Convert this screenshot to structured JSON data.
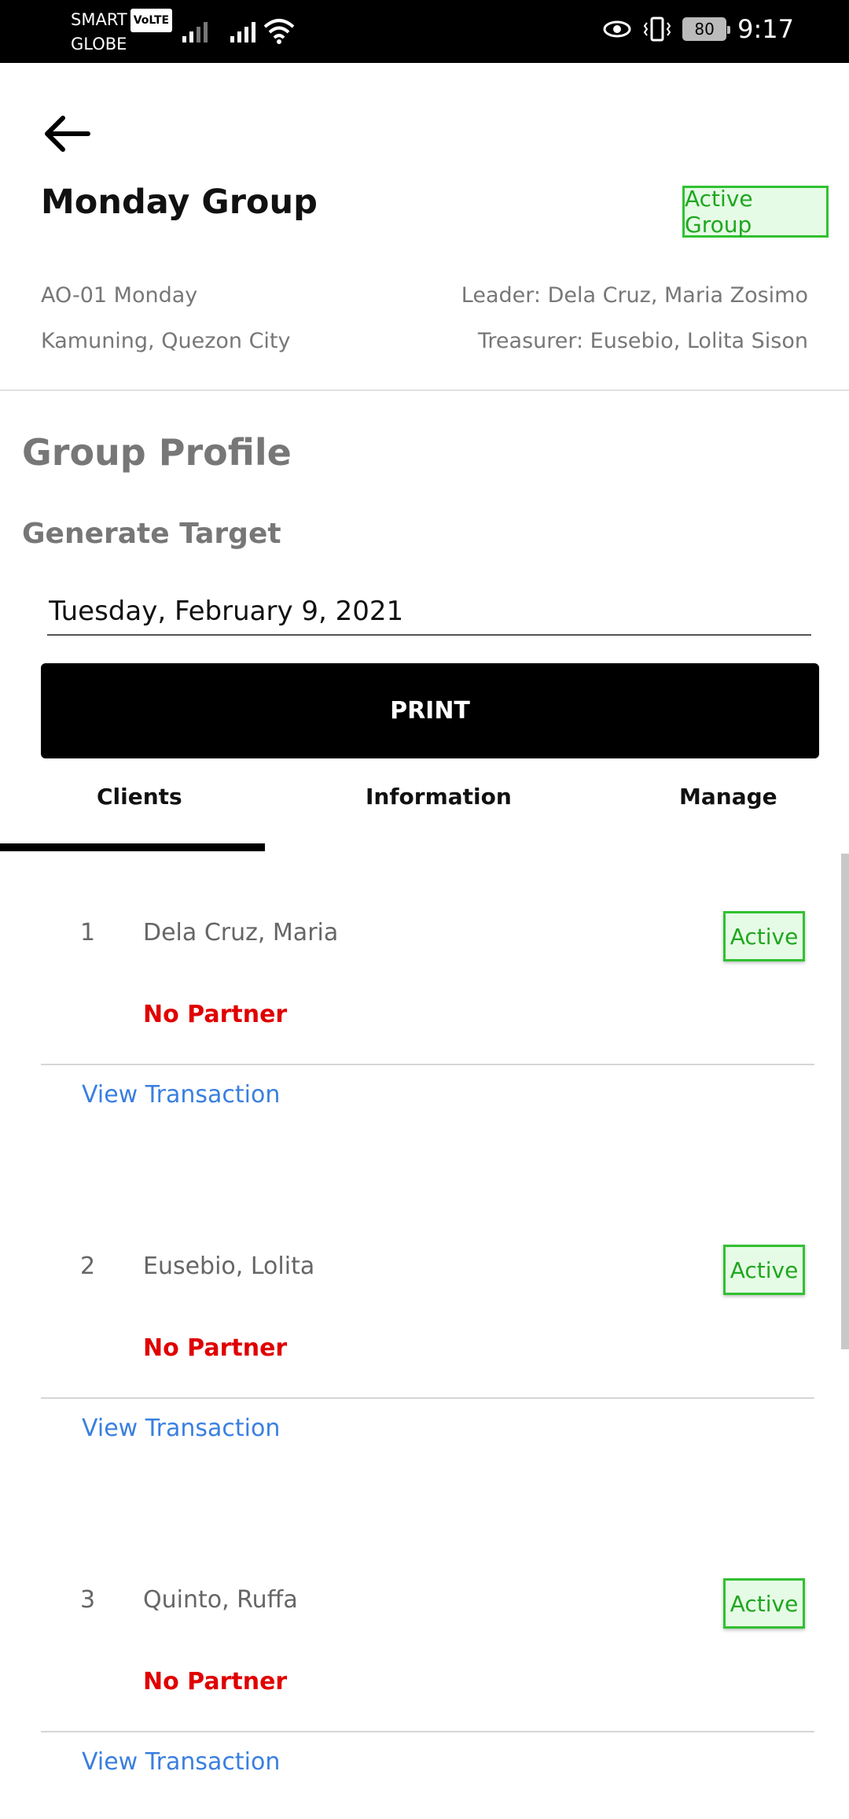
{
  "status_bar": {
    "carrier_top": "SMART",
    "volte": "VoLTE",
    "carrier_bottom": "GLOBE",
    "battery": "80",
    "time": "9:17"
  },
  "header": {
    "title": "Monday Group",
    "badge": "Active Group",
    "code": "AO-01 Monday",
    "location": "Kamuning, Quezon City",
    "leader": "Leader: Dela Cruz, Maria Zosimo",
    "treasurer": "Treasurer: Eusebio, Lolita Sison"
  },
  "profile": {
    "title": "Group Profile",
    "generate_label": "Generate Target",
    "date_value": "Tuesday, February 9, 2021",
    "print_label": "PRINT"
  },
  "tabs": [
    {
      "label": "Clients",
      "active": true
    },
    {
      "label": "Information",
      "active": false
    },
    {
      "label": "Manage",
      "active": false
    }
  ],
  "clients": [
    {
      "num": "1",
      "name": "Dela Cruz, Maria",
      "partner": "No Partner",
      "status": "Active",
      "link": "View Transaction"
    },
    {
      "num": "2",
      "name": "Eusebio, Lolita",
      "partner": "No Partner",
      "status": "Active",
      "link": "View Transaction"
    },
    {
      "num": "3",
      "name": "Quinto, Ruffa",
      "partner": "No Partner",
      "status": "Active",
      "link": "View Transaction"
    }
  ],
  "colors": {
    "accent_green": "#31c131",
    "partner_red": "#e00000",
    "link_blue": "#3a7fe0"
  }
}
